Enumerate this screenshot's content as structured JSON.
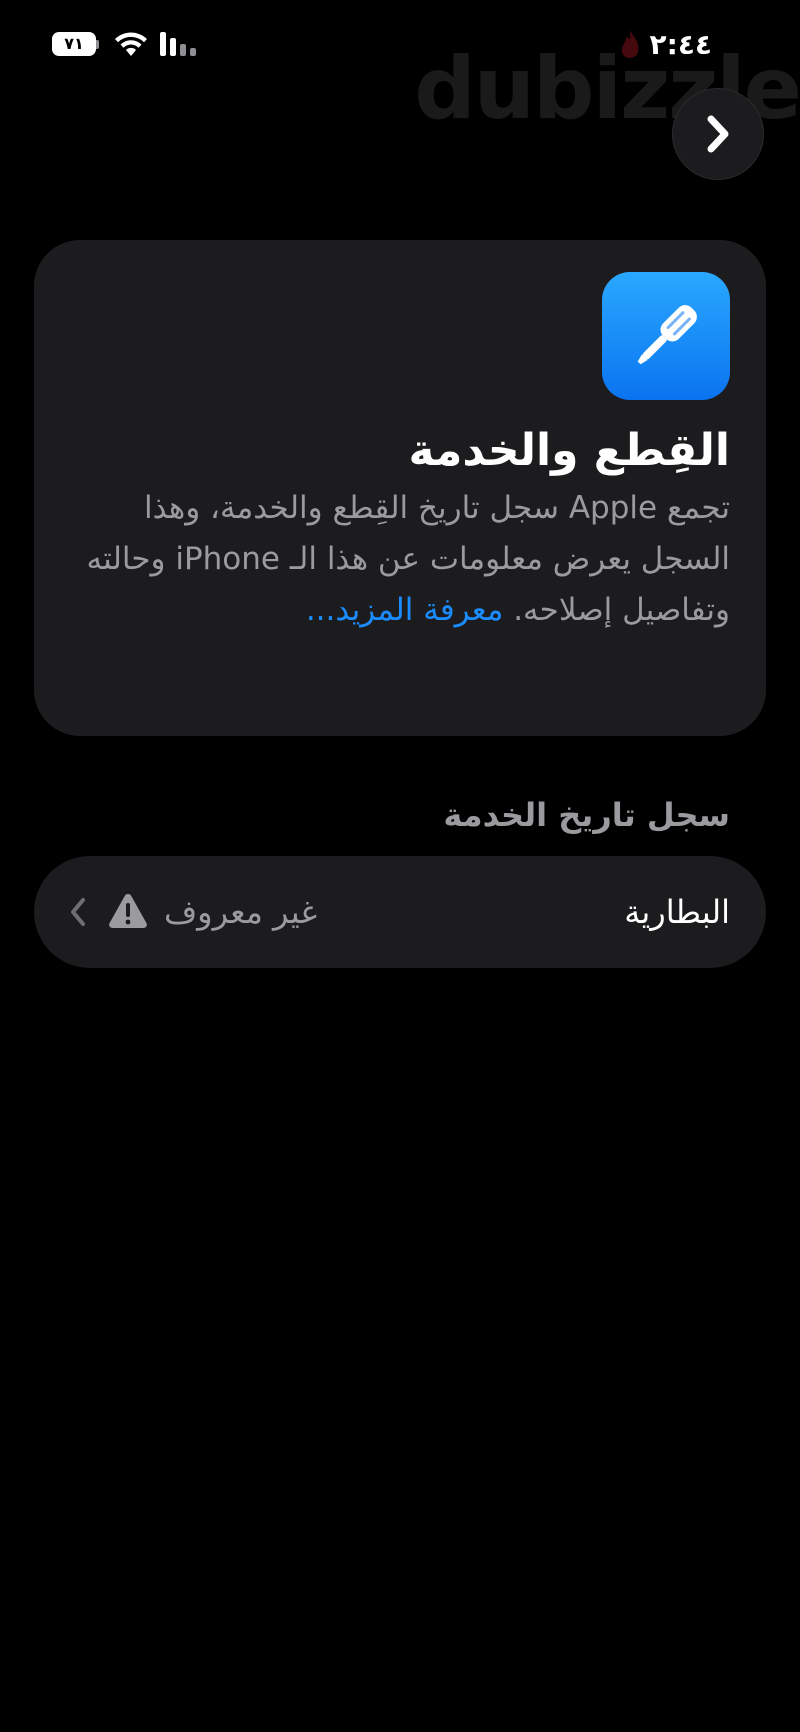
{
  "status_bar": {
    "time": "٢:٤٤",
    "battery_level": "٧١",
    "watermark": "dubizzle"
  },
  "nav": {
    "back_icon": "chevron-right-icon"
  },
  "info_card": {
    "icon": "screwdriver-icon",
    "icon_color": "#0a84ff",
    "title": "القِطع والخدمة",
    "body": "تجمع Apple سجل تاريخ القِطع والخدمة، وهذا السجل يعرض معلومات عن هذا الـ iPhone وحالته وتفاصيل إصلاحه.",
    "learn_more": "معرفة المزيد..."
  },
  "service_history": {
    "header": "سجل تاريخ الخدمة",
    "rows": [
      {
        "label": "البطارية",
        "value": "غير معروف",
        "status_icon": "warning-icon",
        "disclosure_icon": "chevron-left-icon"
      }
    ]
  },
  "colors": {
    "background": "#000000",
    "card": "#1c1c1e",
    "secondary_text": "#9a9a9f",
    "link": "#1a8cff"
  }
}
